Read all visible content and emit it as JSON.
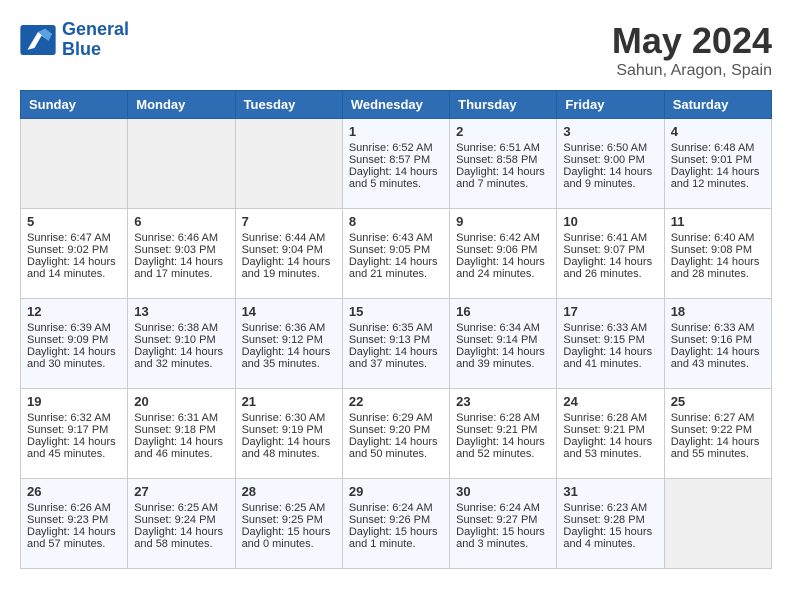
{
  "header": {
    "logo_line1": "General",
    "logo_line2": "Blue",
    "month_title": "May 2024",
    "location": "Sahun, Aragon, Spain"
  },
  "weekdays": [
    "Sunday",
    "Monday",
    "Tuesday",
    "Wednesday",
    "Thursday",
    "Friday",
    "Saturday"
  ],
  "weeks": [
    [
      {
        "day": "",
        "empty": true
      },
      {
        "day": "",
        "empty": true
      },
      {
        "day": "",
        "empty": true
      },
      {
        "day": "1",
        "sunrise": "6:52 AM",
        "sunset": "8:57 PM",
        "daylight": "14 hours and 5 minutes."
      },
      {
        "day": "2",
        "sunrise": "6:51 AM",
        "sunset": "8:58 PM",
        "daylight": "14 hours and 7 minutes."
      },
      {
        "day": "3",
        "sunrise": "6:50 AM",
        "sunset": "9:00 PM",
        "daylight": "14 hours and 9 minutes."
      },
      {
        "day": "4",
        "sunrise": "6:48 AM",
        "sunset": "9:01 PM",
        "daylight": "14 hours and 12 minutes."
      }
    ],
    [
      {
        "day": "5",
        "sunrise": "6:47 AM",
        "sunset": "9:02 PM",
        "daylight": "14 hours and 14 minutes."
      },
      {
        "day": "6",
        "sunrise": "6:46 AM",
        "sunset": "9:03 PM",
        "daylight": "14 hours and 17 minutes."
      },
      {
        "day": "7",
        "sunrise": "6:44 AM",
        "sunset": "9:04 PM",
        "daylight": "14 hours and 19 minutes."
      },
      {
        "day": "8",
        "sunrise": "6:43 AM",
        "sunset": "9:05 PM",
        "daylight": "14 hours and 21 minutes."
      },
      {
        "day": "9",
        "sunrise": "6:42 AM",
        "sunset": "9:06 PM",
        "daylight": "14 hours and 24 minutes."
      },
      {
        "day": "10",
        "sunrise": "6:41 AM",
        "sunset": "9:07 PM",
        "daylight": "14 hours and 26 minutes."
      },
      {
        "day": "11",
        "sunrise": "6:40 AM",
        "sunset": "9:08 PM",
        "daylight": "14 hours and 28 minutes."
      }
    ],
    [
      {
        "day": "12",
        "sunrise": "6:39 AM",
        "sunset": "9:09 PM",
        "daylight": "14 hours and 30 minutes."
      },
      {
        "day": "13",
        "sunrise": "6:38 AM",
        "sunset": "9:10 PM",
        "daylight": "14 hours and 32 minutes."
      },
      {
        "day": "14",
        "sunrise": "6:36 AM",
        "sunset": "9:12 PM",
        "daylight": "14 hours and 35 minutes."
      },
      {
        "day": "15",
        "sunrise": "6:35 AM",
        "sunset": "9:13 PM",
        "daylight": "14 hours and 37 minutes."
      },
      {
        "day": "16",
        "sunrise": "6:34 AM",
        "sunset": "9:14 PM",
        "daylight": "14 hours and 39 minutes."
      },
      {
        "day": "17",
        "sunrise": "6:33 AM",
        "sunset": "9:15 PM",
        "daylight": "14 hours and 41 minutes."
      },
      {
        "day": "18",
        "sunrise": "6:33 AM",
        "sunset": "9:16 PM",
        "daylight": "14 hours and 43 minutes."
      }
    ],
    [
      {
        "day": "19",
        "sunrise": "6:32 AM",
        "sunset": "9:17 PM",
        "daylight": "14 hours and 45 minutes."
      },
      {
        "day": "20",
        "sunrise": "6:31 AM",
        "sunset": "9:18 PM",
        "daylight": "14 hours and 46 minutes."
      },
      {
        "day": "21",
        "sunrise": "6:30 AM",
        "sunset": "9:19 PM",
        "daylight": "14 hours and 48 minutes."
      },
      {
        "day": "22",
        "sunrise": "6:29 AM",
        "sunset": "9:20 PM",
        "daylight": "14 hours and 50 minutes."
      },
      {
        "day": "23",
        "sunrise": "6:28 AM",
        "sunset": "9:21 PM",
        "daylight": "14 hours and 52 minutes."
      },
      {
        "day": "24",
        "sunrise": "6:28 AM",
        "sunset": "9:21 PM",
        "daylight": "14 hours and 53 minutes."
      },
      {
        "day": "25",
        "sunrise": "6:27 AM",
        "sunset": "9:22 PM",
        "daylight": "14 hours and 55 minutes."
      }
    ],
    [
      {
        "day": "26",
        "sunrise": "6:26 AM",
        "sunset": "9:23 PM",
        "daylight": "14 hours and 57 minutes."
      },
      {
        "day": "27",
        "sunrise": "6:25 AM",
        "sunset": "9:24 PM",
        "daylight": "14 hours and 58 minutes."
      },
      {
        "day": "28",
        "sunrise": "6:25 AM",
        "sunset": "9:25 PM",
        "daylight": "15 hours and 0 minutes."
      },
      {
        "day": "29",
        "sunrise": "6:24 AM",
        "sunset": "9:26 PM",
        "daylight": "15 hours and 1 minute."
      },
      {
        "day": "30",
        "sunrise": "6:24 AM",
        "sunset": "9:27 PM",
        "daylight": "15 hours and 3 minutes."
      },
      {
        "day": "31",
        "sunrise": "6:23 AM",
        "sunset": "9:28 PM",
        "daylight": "15 hours and 4 minutes."
      },
      {
        "day": "",
        "empty": true
      }
    ]
  ]
}
